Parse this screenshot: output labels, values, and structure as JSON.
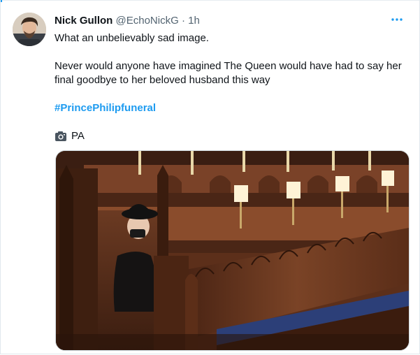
{
  "tweet": {
    "author_name": "Nick Gullon",
    "author_handle": "@EchoNickG",
    "separator": "·",
    "timestamp": "1h",
    "paragraph_1": "What an unbelievably sad image.",
    "paragraph_2": "Never would anyone have imagined The Queen would have had to say her final goodbye to her beloved husband this way",
    "hashtag": "#PrincePhilipfuneral",
    "photo_credit": "PA",
    "more_icon": "more-dots-icon",
    "credit_icon": "camera-icon"
  },
  "colors": {
    "accent": "#1d9bf0",
    "text_primary": "#0f1419",
    "text_secondary": "#536471"
  }
}
